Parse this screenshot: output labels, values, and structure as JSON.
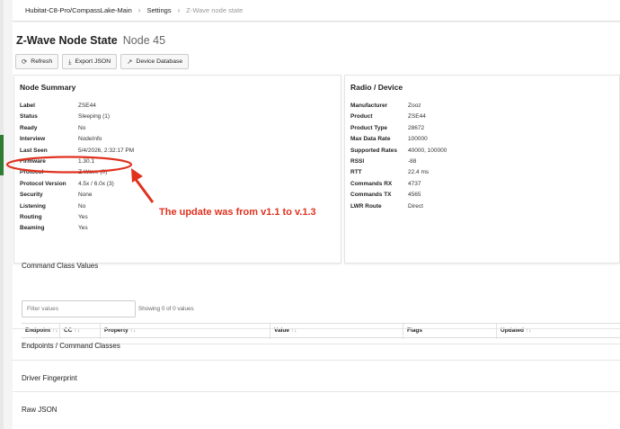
{
  "breadcrumb": {
    "hub": "Hubitat-C8-Pro/CompassLake-Main",
    "settings": "Settings",
    "current": "Z-Wave node state"
  },
  "header": {
    "title": "Z-Wave Node State",
    "subtitle": "Node 45"
  },
  "toolbar": {
    "refresh": "Refresh",
    "export_json": "Export JSON",
    "device_database": "Device Database"
  },
  "node_summary": {
    "title": "Node Summary",
    "rows": [
      {
        "label": "Label",
        "value": "ZSE44"
      },
      {
        "label": "Status",
        "value": "Sleeping (1)"
      },
      {
        "label": "Ready",
        "value": "No"
      },
      {
        "label": "Interview",
        "value": "NodeInfo"
      },
      {
        "label": "Last Seen",
        "value": "5/4/2026, 2:32:17 PM"
      },
      {
        "label": "Firmware",
        "value": "1.30.1"
      },
      {
        "label": "Protocol",
        "value": "Z-Wave (0)"
      },
      {
        "label": "Protocol Version",
        "value": "4.5x / 6.0x (3)"
      },
      {
        "label": "Security",
        "value": "None"
      },
      {
        "label": "Listening",
        "value": "No"
      },
      {
        "label": "Routing",
        "value": "Yes"
      },
      {
        "label": "Beaming",
        "value": "Yes"
      }
    ]
  },
  "radio_device": {
    "title": "Radio / Device",
    "rows": [
      {
        "label": "Manufacturer",
        "value": "Zooz"
      },
      {
        "label": "Product",
        "value": "ZSE44"
      },
      {
        "label": "Product Type",
        "value": "28672"
      },
      {
        "label": "Max Data Rate",
        "value": "100000"
      },
      {
        "label": "Supported Rates",
        "value": "40000, 100000"
      },
      {
        "label": "RSSI",
        "value": "-88"
      },
      {
        "label": "RTT",
        "value": "22.4 ms"
      },
      {
        "label": "Commands RX",
        "value": "4737"
      },
      {
        "label": "Commands TX",
        "value": "4565"
      },
      {
        "label": "LWR Route",
        "value": "Direct"
      }
    ]
  },
  "annotation": {
    "text": "The update was from v1.1 to v.1.3",
    "color": "#e0321f"
  },
  "command_class_values": {
    "title": "Command Class Values",
    "filter_placeholder": "Filter values",
    "showing": "Showing 0 of 0 values",
    "columns": [
      "Endpoint",
      "CC",
      "Property",
      "Value",
      "Flags",
      "Updated"
    ],
    "sort_glyph": "↑↓"
  },
  "sections": {
    "endpoints": "Endpoints / Command Classes",
    "driver": "Driver Fingerprint",
    "raw": "Raw JSON"
  },
  "colors": {
    "status_accent": "#2e7d32"
  }
}
